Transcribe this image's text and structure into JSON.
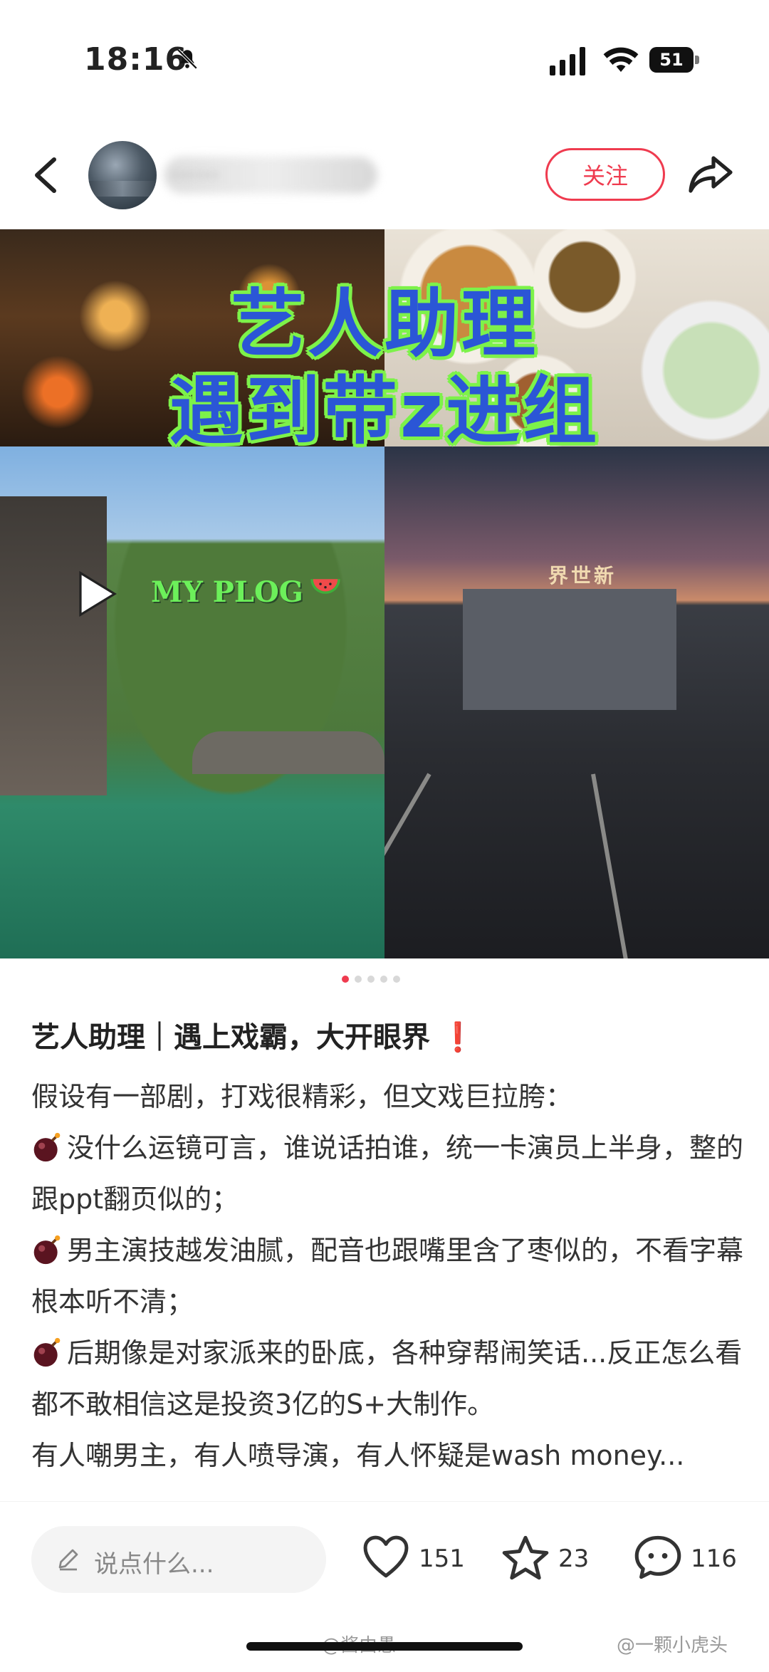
{
  "status_bar": {
    "time": "18:16",
    "battery": "51",
    "icons": [
      "bell-muted-icon",
      "signal-icon",
      "wifi-icon",
      "battery-icon"
    ]
  },
  "header": {
    "username": "······",
    "follow_label": "关注"
  },
  "cover": {
    "overlay_line1": "艺人助理",
    "overlay_line2": "遇到带z进组",
    "tag": "MY PLOG",
    "sign_text": "界世新",
    "page_count": 5,
    "active_page": 1
  },
  "post": {
    "title_main": "艺人助理｜遇上戏霸，大开眼界",
    "title_mark": "❗",
    "paragraphs": [
      {
        "bullet": false,
        "text": "假设有一部剧，打戏很精彩，但文戏巨拉胯："
      },
      {
        "bullet": true,
        "text": "没什么运镜可言，谁说话拍谁，统一卡演员上半身，整的跟ppt翻页似的；"
      },
      {
        "bullet": true,
        "text": "男主演技越发油腻，配音也跟嘴里含了枣似的，不看字幕根本听不清；"
      },
      {
        "bullet": true,
        "text": "后期像是对家派来的卧底，各种穿帮闹笑话...反正怎么看都不敢相信这是投资3亿的S+大制作。"
      },
      {
        "bullet": false,
        "text": "有人嘲男主，有人喷导演，有人怀疑是wash money..."
      }
    ]
  },
  "bottom_bar": {
    "comment_placeholder": "说点什么...",
    "likes": "151",
    "favorites": "23",
    "comments": "116"
  },
  "watermarks": {
    "left": "@酱由愚",
    "right": "@一颗小虎头"
  },
  "colors": {
    "accent": "#ef3b4f",
    "overlay_text": "#2b56d6",
    "overlay_outline": "#7df24a"
  }
}
